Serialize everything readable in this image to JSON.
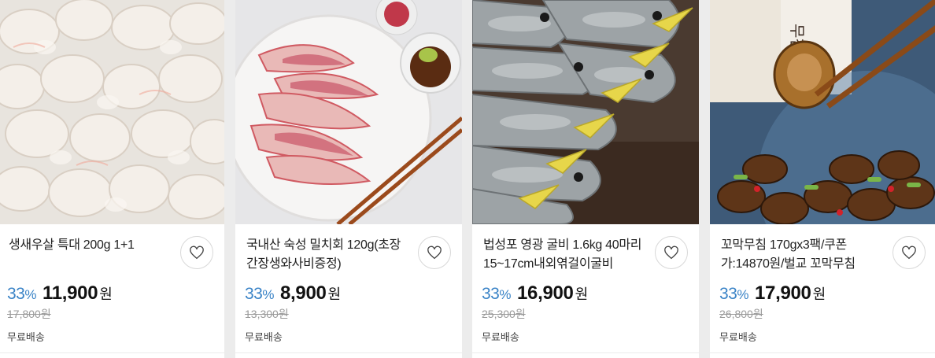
{
  "products": [
    {
      "name": "생새우살 특대 200g 1+1",
      "discount_rate": "33",
      "rate_unit": "%",
      "price": "11,900",
      "currency": "원",
      "original_price": "17,800원",
      "shipping": "무료배송",
      "image_icon": "shrimp-image"
    },
    {
      "name": "국내산 숙성 밀치회 120g(초장간장생와사비증정)",
      "discount_rate": "33",
      "rate_unit": "%",
      "price": "8,900",
      "currency": "원",
      "original_price": "13,300원",
      "shipping": "무료배송",
      "image_icon": "sashimi-image"
    },
    {
      "name": "법성포 영광 굴비 1.6kg 40마리 15~17cm내외엮걸이굴비",
      "discount_rate": "33",
      "rate_unit": "%",
      "price": "16,900",
      "currency": "원",
      "original_price": "25,300원",
      "shipping": "무료배송",
      "image_icon": "dried-fish-image"
    },
    {
      "name": "꼬막무침 170gx3팩/쿠폰가:14870원/벌교 꼬막무침",
      "discount_rate": "33",
      "rate_unit": "%",
      "price": "17,900",
      "currency": "원",
      "original_price": "26,800원",
      "shipping": "무료배송",
      "image_icon": "cockle-image",
      "package_text": "무침"
    }
  ],
  "wishlist_icon": "heart-icon",
  "colors": {
    "discount": "#3b84c7",
    "background": "#ececec"
  }
}
